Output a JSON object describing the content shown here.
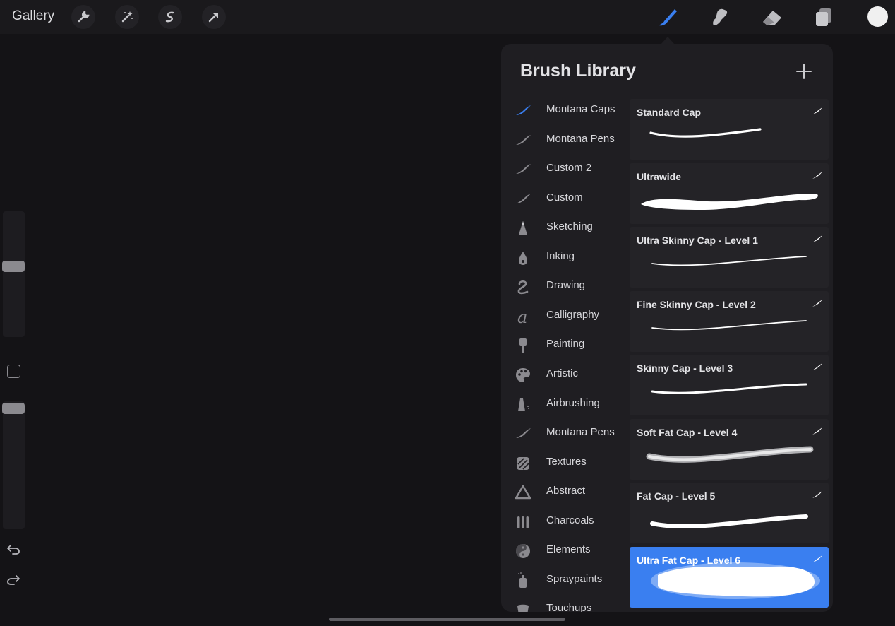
{
  "topbar": {
    "gallery_label": "Gallery",
    "left_tools": [
      "wrench-icon",
      "magic-wand-icon",
      "selection-s-icon",
      "transform-arrow-icon"
    ],
    "right_tools": [
      "brush-icon",
      "smudge-icon",
      "eraser-icon",
      "layers-icon"
    ],
    "active_tool": "brush-icon",
    "active_color": "#f0f0f0",
    "accent_color": "#3a7ff0"
  },
  "sidebar": {
    "brush_size_level": 0.56,
    "opacity_level": 1.0,
    "icons": [
      "modify-square-icon",
      "undo-icon",
      "redo-icon"
    ]
  },
  "brush_library": {
    "title": "Brush Library",
    "add_icon": "plus-icon",
    "sets": [
      {
        "label": "Montana Caps",
        "icon": "stroke-icon",
        "active": true
      },
      {
        "label": "Montana Pens",
        "icon": "stroke-icon"
      },
      {
        "label": "Custom 2",
        "icon": "stroke-icon"
      },
      {
        "label": "Custom",
        "icon": "stroke-icon"
      },
      {
        "label": "Sketching",
        "icon": "pencil-tip-icon"
      },
      {
        "label": "Inking",
        "icon": "ink-drop-icon"
      },
      {
        "label": "Drawing",
        "icon": "squiggle-icon"
      },
      {
        "label": "Calligraphy",
        "icon": "script-a-icon"
      },
      {
        "label": "Painting",
        "icon": "paintbrush-icon"
      },
      {
        "label": "Artistic",
        "icon": "palette-icon"
      },
      {
        "label": "Airbrushing",
        "icon": "airbrush-icon"
      },
      {
        "label": "Montana Pens",
        "icon": "stroke-icon"
      },
      {
        "label": "Textures",
        "icon": "hatch-icon"
      },
      {
        "label": "Abstract",
        "icon": "triangle-icon"
      },
      {
        "label": "Charcoals",
        "icon": "charcoal-sticks-icon"
      },
      {
        "label": "Elements",
        "icon": "yin-yang-icon"
      },
      {
        "label": "Spraypaints",
        "icon": "spray-can-icon"
      },
      {
        "label": "Touchups",
        "icon": "touchup-icon"
      }
    ],
    "brushes": [
      {
        "name": "Standard Cap",
        "stroke": "thin"
      },
      {
        "name": "Ultrawide",
        "stroke": "wide"
      },
      {
        "name": "Ultra Skinny Cap - Level 1",
        "stroke": "skinny"
      },
      {
        "name": "Fine Skinny Cap - Level 2",
        "stroke": "skinny"
      },
      {
        "name": "Skinny Cap - Level 3",
        "stroke": "medium"
      },
      {
        "name": "Soft Fat Cap - Level 4",
        "stroke": "soft"
      },
      {
        "name": "Fat Cap - Level 5",
        "stroke": "fat"
      },
      {
        "name": "Ultra Fat Cap - Level 6",
        "stroke": "ultrafat",
        "selected": true
      }
    ]
  }
}
